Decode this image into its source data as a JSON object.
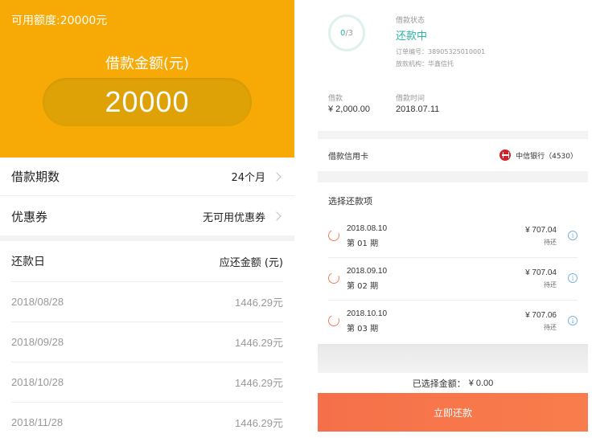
{
  "left": {
    "available_quota": "可用额度:20000元",
    "amount_label": "借款金额(元)",
    "amount_value": "20000",
    "term": {
      "label": "借款期数",
      "value": "24个月"
    },
    "coupon": {
      "label": "优惠券",
      "value": "无可用优惠券"
    },
    "schedule": {
      "date_header": "还款日",
      "amount_header": "应还金额 (元)",
      "rows": [
        {
          "date": "2018/08/28",
          "amount": "1446.29元"
        },
        {
          "date": "2018/09/28",
          "amount": "1446.29元"
        },
        {
          "date": "2018/10/28",
          "amount": "1446.29元"
        },
        {
          "date": "2018/11/28",
          "amount": "1446.29元"
        }
      ]
    }
  },
  "right": {
    "progress": {
      "done": "0",
      "total": "/3"
    },
    "status_label": "借款状态",
    "status_value": "还款中",
    "order_no": "订单编号：38905325010001",
    "institution": "放款机构：华鑫信托",
    "loan": {
      "label": "借款",
      "value": "¥ 2,000.00"
    },
    "loan_time": {
      "label": "借款时间",
      "value": "2018.07.11"
    },
    "card": {
      "label": "借款信用卡",
      "bank": "中信银行",
      "tail": "（4530）"
    },
    "pick_title": "选择还款项",
    "installments": [
      {
        "date": "2018.08.10",
        "period": "第 01 期",
        "amount": "¥ 707.04",
        "status": "待还"
      },
      {
        "date": "2018.09.10",
        "period": "第 02 期",
        "amount": "¥ 707.04",
        "status": "待还"
      },
      {
        "date": "2018.10.10",
        "period": "第 03 期",
        "amount": "¥ 707.06",
        "status": "待还"
      }
    ],
    "selected_label": "已选择金额：",
    "selected_value": "¥ 0.00",
    "pay_button": "立即还款",
    "info_glyph": "i"
  },
  "colors": {
    "brand_orange": "#f7aa06",
    "accent_teal": "#2bb3a6",
    "pay_button": "#f5704a",
    "bank_red": "#cf2128"
  }
}
